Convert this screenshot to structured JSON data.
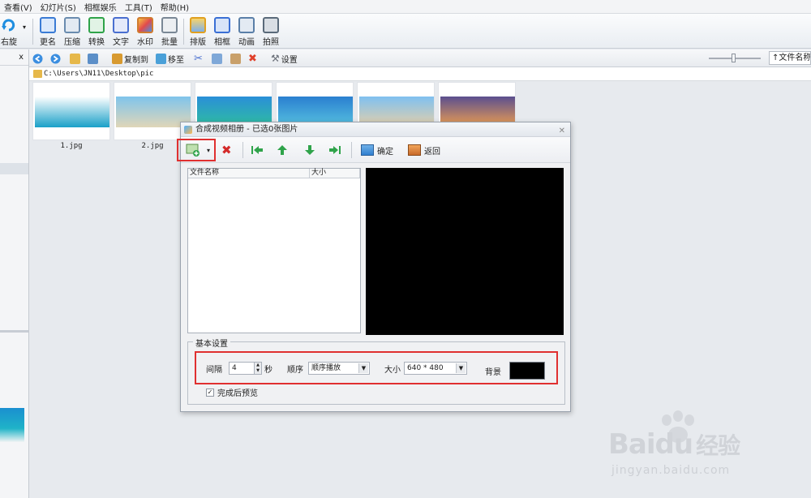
{
  "menu": [
    "查看(V)",
    "幻灯片(S)",
    "相框娱乐",
    "工具(T)",
    "帮助(H)"
  ],
  "toolbar": {
    "rotate_right": "右旋",
    "buttons": [
      {
        "label": "更名",
        "color": "#3a7bd5"
      },
      {
        "label": "压缩",
        "color": "#6a8caf"
      },
      {
        "label": "转换",
        "color": "#2fa34a"
      },
      {
        "label": "文字",
        "color": "#4a6fd0"
      },
      {
        "label": "水印",
        "color": "#d07b2f"
      },
      {
        "label": "批量",
        "color": "#7a8896"
      },
      {
        "label": "排版",
        "color": "#e0a020"
      },
      {
        "label": "相框",
        "color": "#3a6fd5"
      },
      {
        "label": "动画",
        "color": "#5a7fa8"
      },
      {
        "label": "拍照",
        "color": "#5a6a7a"
      }
    ]
  },
  "toolbar2": {
    "copy_to": "复制到",
    "move_to": "移至",
    "settings": "设置",
    "sort": "↑文件名称"
  },
  "left_panel": {
    "collapse": "x"
  },
  "path": "C:\\Users\\JN11\\Desktop\\pic",
  "thumbnails": [
    {
      "label": "1.jpg",
      "top": "#ffffff",
      "bottom": "#1aa0c8"
    },
    {
      "label": "2.jpg",
      "top": "#7fc4ec",
      "bottom": "#e0d6b8"
    },
    {
      "label": "",
      "top": "#2a8fd8",
      "bottom": "#2fbf9f"
    },
    {
      "label": "",
      "top": "#2a7fd0",
      "bottom": "#58c3e0"
    },
    {
      "label": "",
      "top": "#7fc0f0",
      "bottom": "#e7d0a8"
    },
    {
      "label": "",
      "top": "#5a4f8f",
      "bottom": "#f0a050"
    }
  ],
  "dialog": {
    "title": "合成视频相册 - 已选0张图片",
    "confirm": "确定",
    "back": "返回",
    "col_name": "文件名称",
    "col_size": "大小",
    "group_label": "基本设置",
    "interval_label": "间隔",
    "interval_value": "4",
    "seconds": "秒",
    "order_label": "顺序",
    "order_value": "顺序播放",
    "size_label": "大小",
    "size_value": "640 * 480",
    "bg_label": "背景",
    "bg_color": "#000000",
    "preview_label": "完成后预览",
    "preview_checked": "✓"
  },
  "watermark": {
    "brand": "Bai",
    "brand2": "du",
    "cn": "经验",
    "url": "jingyan.baidu.com"
  },
  "colors": {
    "highlight": "#e03030",
    "preview_bg": "#000000"
  }
}
